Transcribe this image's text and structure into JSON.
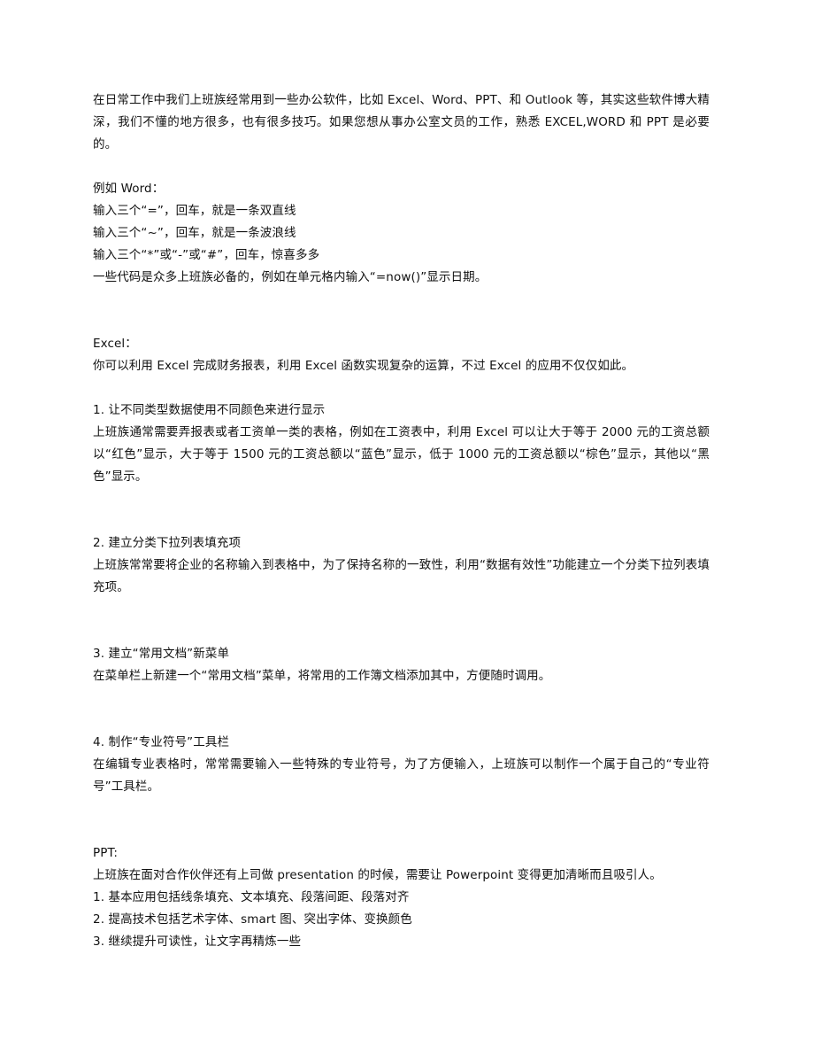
{
  "document": {
    "page_background": "#ffffff",
    "text_color": "#111111",
    "blocks": [
      {
        "id": "intro",
        "type": "paragraph",
        "text": "在日常工作中我们上班族经常用到一些办公软件，比如 Excel、Word、PPT、和 Outlook 等，其实这些软件博大精深，我们不懂的地方很多，也有很多技巧。如果您想从事办公室文员的工作，熟悉 EXCEL,WORD 和 PPT 是必要的。"
      },
      {
        "id": "word-heading",
        "type": "heading",
        "text": "例如 Word："
      },
      {
        "id": "word-tip-1",
        "type": "line",
        "text": "输入三个“=”，回车，就是一条双直线"
      },
      {
        "id": "word-tip-2",
        "type": "line",
        "text": "输入三个“~”，回车，就是一条波浪线"
      },
      {
        "id": "word-tip-3",
        "type": "line",
        "text": "输入三个“*”或“-”或“#”，回车，惊喜多多"
      },
      {
        "id": "word-tip-4",
        "type": "line",
        "text": "一些代码是众多上班族必备的，例如在单元格内输入“=now()”显示日期。"
      },
      {
        "id": "excel-heading",
        "type": "heading",
        "text": "Excel："
      },
      {
        "id": "excel-intro",
        "type": "paragraph",
        "text": "你可以利用 Excel 完成财务报表，利用 Excel 函数实现复杂的运算，不过 Excel 的应用不仅仅如此。"
      },
      {
        "id": "excel-tip-1-title",
        "type": "heading",
        "text": "1. 让不同类型数据使用不同颜色来进行显示"
      },
      {
        "id": "excel-tip-1-body",
        "type": "paragraph",
        "text": "上班族通常需要弄报表或者工资单一类的表格，例如在工资表中，利用 Excel 可以让大于等于 2000 元的工资总额以“红色”显示，大于等于 1500 元的工资总额以“蓝色”显示，低于 1000 元的工资总额以“棕色”显示，其他以“黑色”显示。"
      },
      {
        "id": "excel-tip-2-title",
        "type": "heading",
        "text": "2. 建立分类下拉列表填充项"
      },
      {
        "id": "excel-tip-2-body",
        "type": "paragraph",
        "text": "上班族常常要将企业的名称输入到表格中，为了保持名称的一致性，利用“数据有效性”功能建立一个分类下拉列表填充项。"
      },
      {
        "id": "excel-tip-3-title",
        "type": "heading",
        "text": "3. 建立“常用文档”新菜单"
      },
      {
        "id": "excel-tip-3-body",
        "type": "paragraph",
        "text": "在菜单栏上新建一个“常用文档”菜单，将常用的工作簿文档添加其中，方便随时调用。"
      },
      {
        "id": "excel-tip-4-title",
        "type": "heading",
        "text": "4. 制作“专业符号”工具栏"
      },
      {
        "id": "excel-tip-4-body",
        "type": "paragraph",
        "text": "在编辑专业表格时，常常需要输入一些特殊的专业符号，为了方便输入，上班族可以制作一个属于自己的“专业符号”工具栏。"
      },
      {
        "id": "ppt-heading",
        "type": "heading",
        "text": "PPT:"
      },
      {
        "id": "ppt-intro",
        "type": "paragraph",
        "text": "上班族在面对合作伙伴还有上司做 presentation 的时候，需要让 Powerpoint 变得更加清晰而且吸引人。"
      },
      {
        "id": "ppt-tip-1",
        "type": "line",
        "text": "1. 基本应用包括线条填充、文本填充、段落间距、段落对齐"
      },
      {
        "id": "ppt-tip-2",
        "type": "line",
        "text": "2. 提高技术包括艺术字体、smart 图、突出字体、变换颜色"
      },
      {
        "id": "ppt-tip-3",
        "type": "line",
        "text": "3. 继续提升可读性，让文字再精炼一些"
      }
    ]
  }
}
